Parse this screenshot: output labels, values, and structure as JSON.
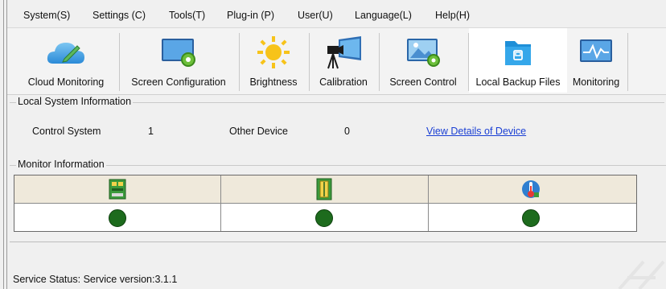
{
  "menu": [
    {
      "label": "System(S)",
      "icon": "",
      "id": "system"
    },
    {
      "label": "Settings (C)",
      "id": "settings"
    },
    {
      "label": "Tools(T)",
      "id": "tools"
    },
    {
      "label": "Plug-in (P)",
      "id": "plugin"
    },
    {
      "label": "User(U)",
      "id": "user"
    },
    {
      "label": "Language(L)",
      "id": "language"
    },
    {
      "label": "Help(H)",
      "id": "help"
    }
  ],
  "toolbar": {
    "cloud_monitoring": "Cloud Monitoring",
    "screen_configuration": "Screen Configuration",
    "brightness": "Brightness",
    "calibration": "Calibration",
    "screen_control": "Screen Control",
    "local_backup_files": "Local Backup Files",
    "monitoring": "Monitoring"
  },
  "local_info": {
    "title": "Local System Information",
    "control_system_label": "Control System",
    "control_system_value": "1",
    "other_device_label": "Other Device",
    "other_device_value": "0",
    "details_link": "View Details of Device"
  },
  "monitor": {
    "title": "Monitor Information",
    "columns": [
      {
        "icon": "receiving-card-icon",
        "status": "normal"
      },
      {
        "icon": "module-icon",
        "status": "normal"
      },
      {
        "icon": "temperature-icon",
        "status": "normal"
      }
    ],
    "status_color": "#1d6b1d"
  },
  "status": {
    "label": "Service Status:",
    "version": "Service version:3.1.1"
  }
}
